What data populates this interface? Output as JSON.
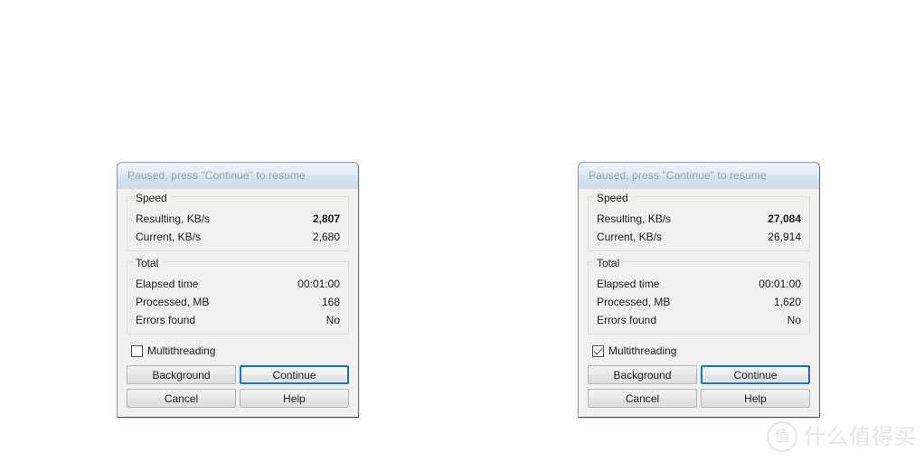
{
  "dialogs": [
    {
      "title": "Paused, press \"Continue\" to resume",
      "speed": {
        "group_label": "Speed",
        "rows": [
          {
            "label": "Resulting, KB/s",
            "value": "2,807",
            "bold": true
          },
          {
            "label": "Current, KB/s",
            "value": "2,680",
            "bold": false
          }
        ]
      },
      "total": {
        "group_label": "Total",
        "rows": [
          {
            "label": "Elapsed time",
            "value": "00:01:00",
            "bold": false
          },
          {
            "label": "Processed, MB",
            "value": "168",
            "bold": false
          },
          {
            "label": "Errors found",
            "value": "No",
            "bold": false
          }
        ]
      },
      "multithreading": {
        "label": "Multithreading",
        "checked": false
      },
      "buttons": {
        "background": "Background",
        "continue": "Continue",
        "cancel": "Cancel",
        "help": "Help"
      }
    },
    {
      "title": "Paused, press \"Continue\" to resume",
      "speed": {
        "group_label": "Speed",
        "rows": [
          {
            "label": "Resulting, KB/s",
            "value": "27,084",
            "bold": true
          },
          {
            "label": "Current, KB/s",
            "value": "26,914",
            "bold": false
          }
        ]
      },
      "total": {
        "group_label": "Total",
        "rows": [
          {
            "label": "Elapsed time",
            "value": "00:01:00",
            "bold": false
          },
          {
            "label": "Processed, MB",
            "value": "1,620",
            "bold": false
          },
          {
            "label": "Errors found",
            "value": "No",
            "bold": false
          }
        ]
      },
      "multithreading": {
        "label": "Multithreading",
        "checked": true
      },
      "buttons": {
        "background": "Background",
        "continue": "Continue",
        "cancel": "Cancel",
        "help": "Help"
      }
    }
  ],
  "watermark": {
    "badge": "值",
    "text": "什么值得买"
  },
  "colors": {
    "dialog_background": "#f0f0f0",
    "title_text": "#9aa3ab",
    "body_text": "#1b1b1b",
    "default_button_border": "#1573c0",
    "groupbox_border": "#dfdfdf",
    "watermark": "#e6e6e6"
  }
}
